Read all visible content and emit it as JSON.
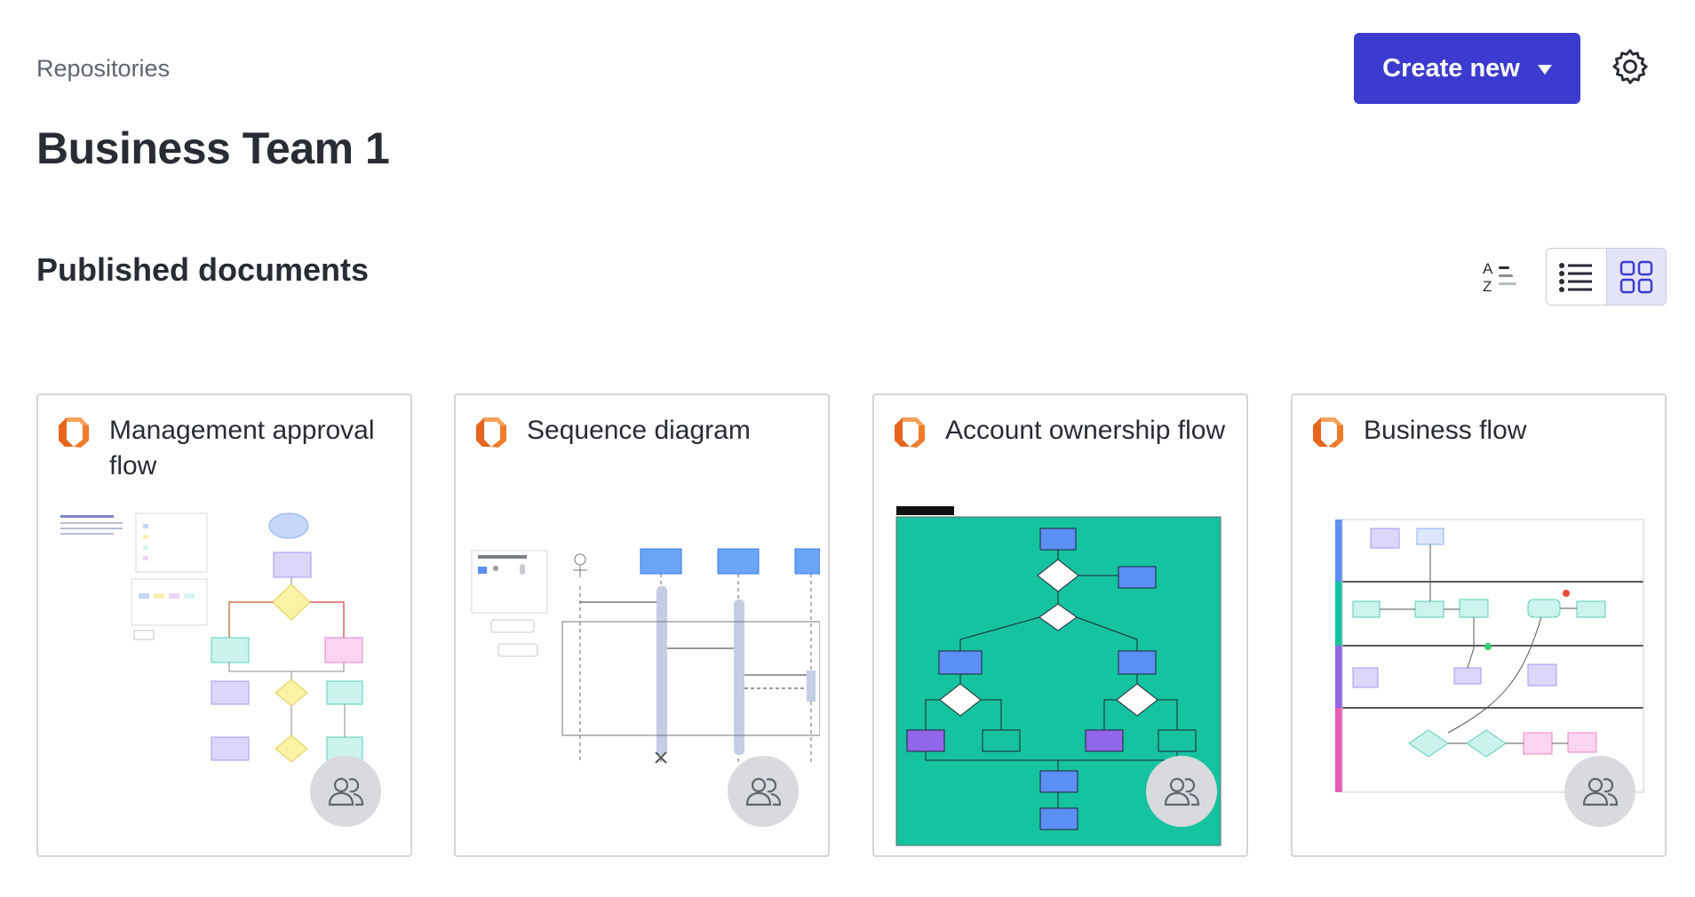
{
  "breadcrumb": "Repositories",
  "page_title": "Business Team 1",
  "header": {
    "create_label": "Create new",
    "create_icon": "caret-down-icon",
    "settings_icon": "gear-icon"
  },
  "section": {
    "title": "Published documents",
    "sort_icon": "sort-az-icon",
    "view_options": [
      {
        "icon": "list-view-icon",
        "active": false
      },
      {
        "icon": "grid-view-icon",
        "active": true
      }
    ]
  },
  "documents": [
    {
      "title": "Management approval flow",
      "icon": "lucid-logo-icon",
      "shared_icon": "shared-users-icon"
    },
    {
      "title": "Sequence diagram",
      "icon": "lucid-logo-icon",
      "shared_icon": "shared-users-icon"
    },
    {
      "title": "Account ownership flow",
      "icon": "lucid-logo-icon",
      "shared_icon": "shared-users-icon"
    },
    {
      "title": "Business flow",
      "icon": "lucid-logo-icon",
      "shared_icon": "shared-users-icon"
    }
  ],
  "colors": {
    "accent": "#3b3ccf",
    "logo_orange": "#f07b2b",
    "thumb_teal": "#15c3a0",
    "thumb_blue": "#5b8ff5"
  }
}
